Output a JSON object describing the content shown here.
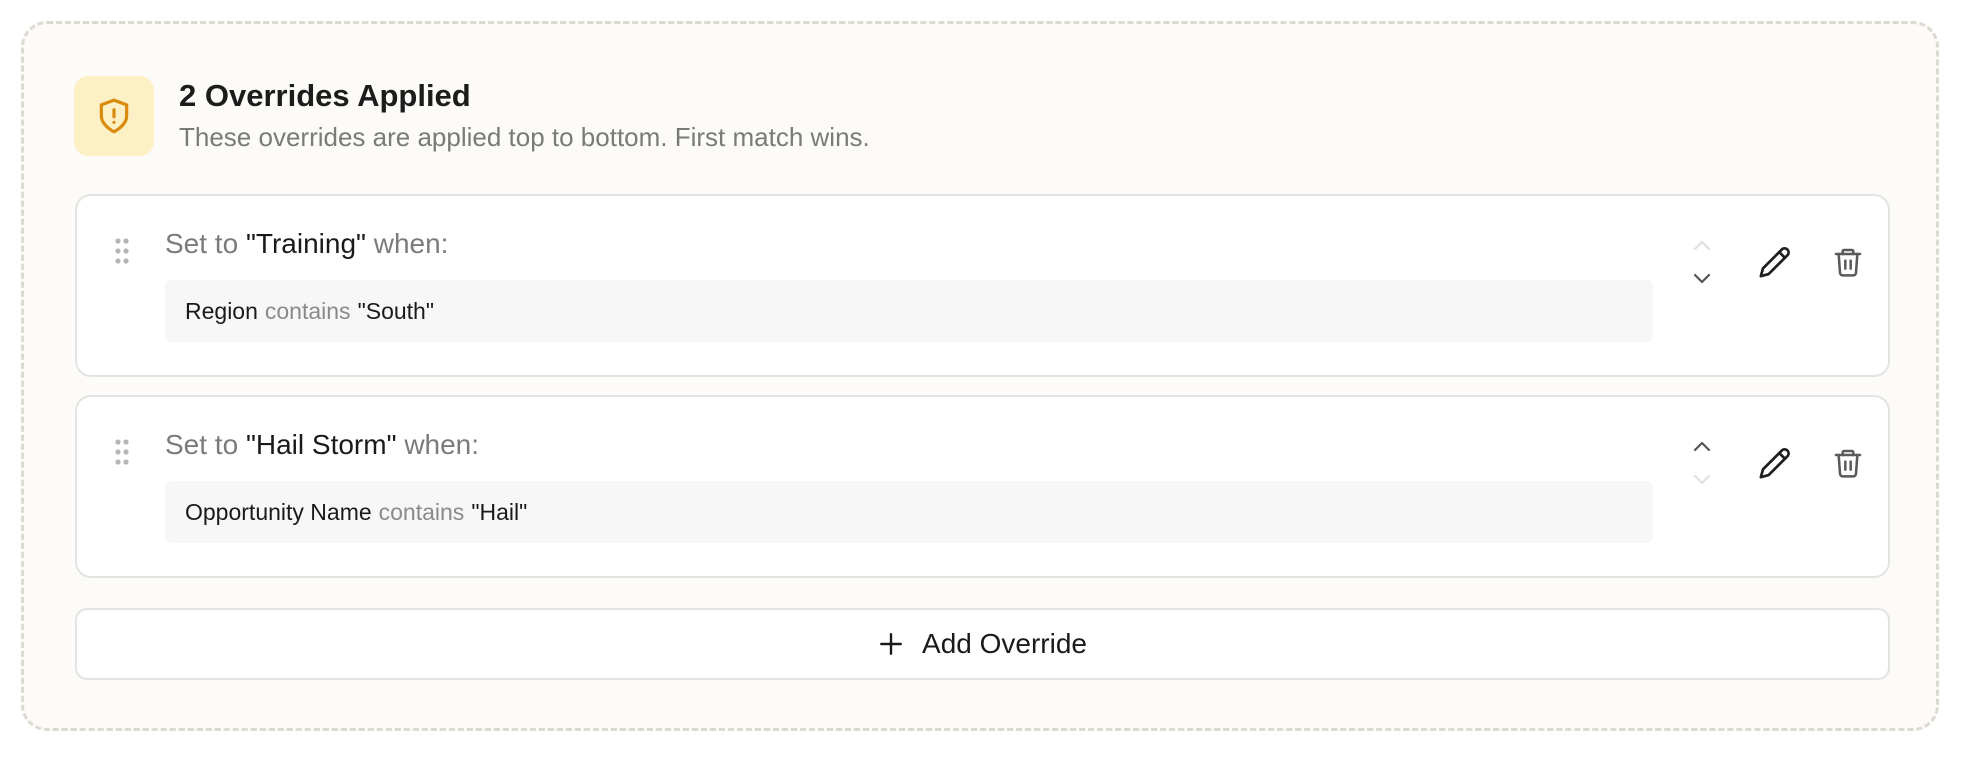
{
  "header": {
    "icon": "shield-alert-icon",
    "title": "2 Overrides Applied",
    "subtitle": "These overrides are applied top to bottom. First match wins."
  },
  "rules": [
    {
      "prefix": "Set to",
      "value": "\"Training\"",
      "suffix": "when:",
      "condition": {
        "field": "Region",
        "operator": "contains",
        "value": "\"South\""
      },
      "move_up_enabled": false,
      "move_down_enabled": true
    },
    {
      "prefix": "Set to",
      "value": "\"Hail Storm\"",
      "suffix": "when:",
      "condition": {
        "field": "Opportunity Name",
        "operator": "contains",
        "value": "\"Hail\""
      },
      "move_up_enabled": true,
      "move_down_enabled": false
    }
  ],
  "add_button": {
    "label": "Add Override",
    "icon": "plus-icon"
  },
  "colors": {
    "panel_bg": "#fcfbf7",
    "icon_bg": "#fdf0c5",
    "icon_fg": "#d98a0b",
    "muted_text": "#7b7b7b",
    "strong_text": "#1a1a1a"
  }
}
